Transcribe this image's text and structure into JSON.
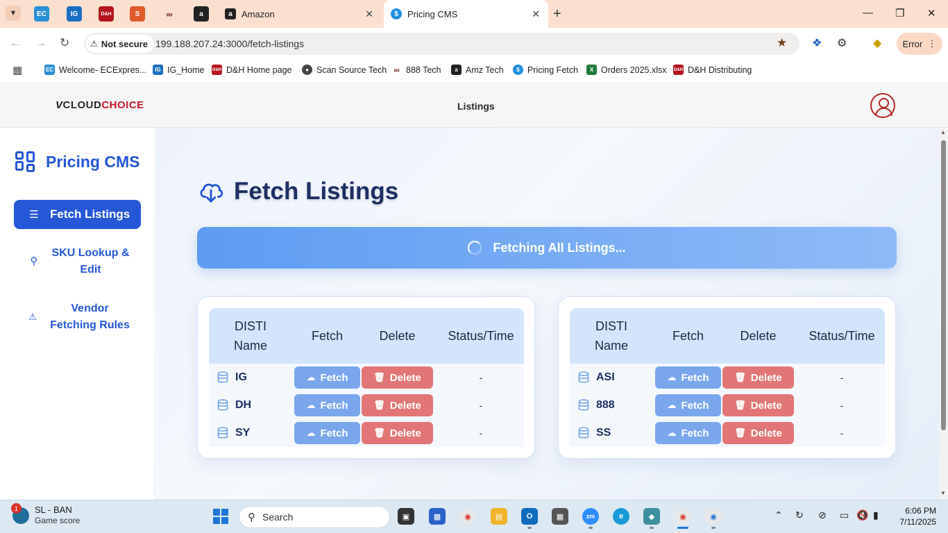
{
  "browser": {
    "tabs": [
      {
        "label": "Amazon"
      },
      {
        "label": "Pricing CMS",
        "active": true
      }
    ],
    "pinned_tabs": [
      "EC",
      "IG",
      "D&H",
      "Scan Source",
      "888",
      "Amazon"
    ],
    "security": "Not secure",
    "url": "199.188.207.24:3000/fetch-listings",
    "error_button": "Error",
    "bookmarks": [
      {
        "label": "Welcome- ECExpres...",
        "icon": "EC"
      },
      {
        "label": "IG_Home",
        "icon": "IG"
      },
      {
        "label": "D&H Home page",
        "icon": "D&H"
      },
      {
        "label": "Scan Source Tech",
        "icon": "SS"
      },
      {
        "label": "888 Tech",
        "icon": "888"
      },
      {
        "label": "Amz Tech",
        "icon": "a"
      },
      {
        "label": "Pricing Fetch",
        "icon": "$"
      },
      {
        "label": "Orders 2025.xlsx",
        "icon": "X"
      },
      {
        "label": "D&H Distributing",
        "icon": "D&H"
      }
    ]
  },
  "header": {
    "logo": {
      "v": "V",
      "cloud": "CLOUD",
      "choice": "CHOICE"
    },
    "nav_title": "Listings"
  },
  "sidebar": {
    "brand": "Pricing CMS",
    "items": [
      {
        "label": "Fetch Listings",
        "icon": "list-icon",
        "active": true
      },
      {
        "label": "SKU Lookup & Edit",
        "line1": "SKU Lookup &",
        "line2": "Edit",
        "icon": "search-icon"
      },
      {
        "label": "Vendor Fetching Rules",
        "line1": "Vendor",
        "line2": "Fetching Rules",
        "icon": "warning-icon"
      }
    ]
  },
  "main": {
    "title": "Fetch Listings",
    "fetch_all_label": "Fetching All Listings...",
    "table_headers": {
      "name_line1": "DISTI",
      "name_line2": "Name",
      "fetch": "Fetch",
      "delete": "Delete",
      "status": "Status/Time"
    },
    "fetch_label": "Fetch",
    "delete_label": "Delete",
    "left_table": [
      {
        "name": "IG",
        "status": "-"
      },
      {
        "name": "DH",
        "status": "-"
      },
      {
        "name": "SY",
        "status": "-"
      }
    ],
    "right_table": [
      {
        "name": "ASI",
        "status": "-"
      },
      {
        "name": "888",
        "status": "-"
      },
      {
        "name": "SS",
        "status": "-"
      }
    ]
  },
  "taskbar": {
    "weather_badge": "1",
    "weather_line1": "SL - BAN",
    "weather_line2": "Game score",
    "search_placeholder": "Search",
    "time": "6:06 PM",
    "date": "7/11/2025"
  },
  "colors": {
    "accent": "#2557d6",
    "fetch_button": "#7aa6ec",
    "delete_button": "#e27676",
    "brand_red": "#c8182a"
  }
}
